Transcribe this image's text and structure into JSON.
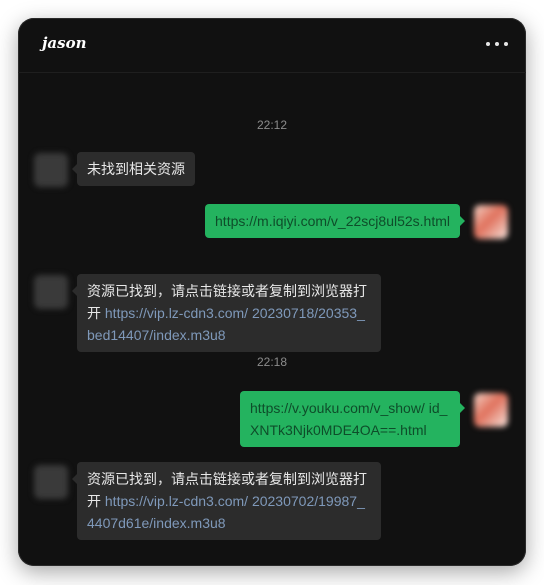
{
  "header": {
    "title": "jason",
    "more_icon": "more-horizontal-icon"
  },
  "chat": {
    "timestamps": [
      "22:12",
      "22:18"
    ],
    "messages": [
      {
        "dir": "in",
        "text": "未找到相关资源"
      },
      {
        "dir": "out",
        "link": "https://m.iqiyi.com/v_22scj8ul52s.html"
      },
      {
        "dir": "in",
        "text": "资源已找到，请点击链接或者复制到浏览器打开",
        "link_line1": "https://vip.lz-cdn3.com/",
        "link_line2": "20230718/20353_bed14407/index.m3u8"
      },
      {
        "dir": "out",
        "link_line1": "https://v.youku.com/v_show/",
        "link_line2": "id_XNTk3Njk0MDE4OA==.html"
      },
      {
        "dir": "in",
        "text": "资源已找到，请点击链接或者复制到浏览器打开",
        "link_line1": "https://vip.lz-cdn3.com/",
        "link_line2": "20230702/19987_4407d61e/index.m3u8"
      }
    ]
  },
  "colors": {
    "background": "#111111",
    "incoming_bubble": "#2c2c2c",
    "outgoing_bubble": "#24b35f",
    "link": "#7f99ba"
  }
}
